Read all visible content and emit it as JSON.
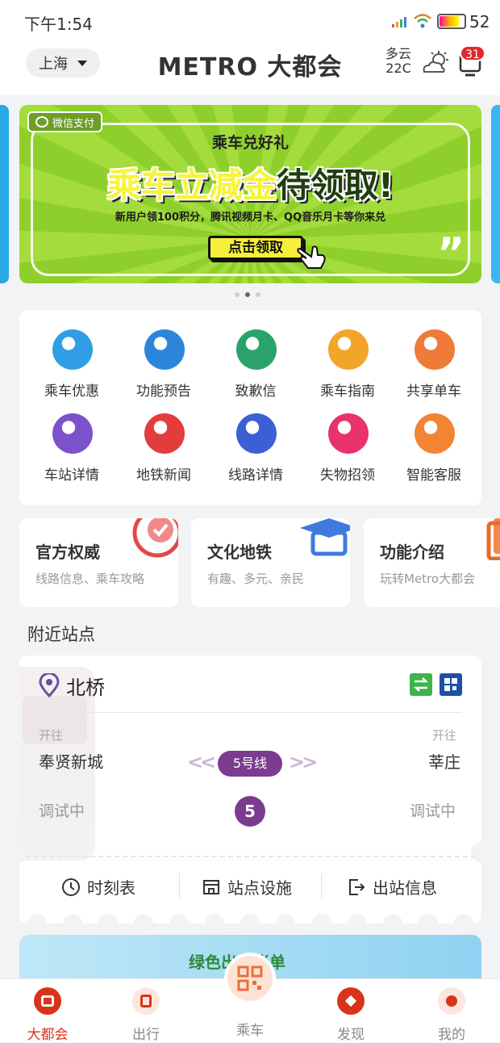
{
  "status_bar": {
    "time": "下午1:54",
    "battery": "52"
  },
  "header": {
    "city": "上海",
    "title": "METRO 大都会",
    "weather_desc": "多云",
    "weather_temp": "22C",
    "message_badge": "31"
  },
  "banner": {
    "tag": "微信支付",
    "subtitle": "乘车兑好礼",
    "headline_part1": "乘车立减金",
    "headline_part2": "待领取!",
    "description": "新用户领100积分，腾讯视频月卡、QQ音乐月卡等你来兑",
    "button": "点击领取",
    "page_count": 3,
    "active_page": 2
  },
  "quick_services": [
    {
      "label": "乘车优惠",
      "icon": "ticket-icon",
      "color": "#2f9ee6"
    },
    {
      "label": "功能预告",
      "icon": "pie-chart-icon",
      "color": "#2b86d9"
    },
    {
      "label": "致歉信",
      "icon": "letter-icon",
      "color": "#2aa36b"
    },
    {
      "label": "乘车指南",
      "icon": "guide-icon",
      "color": "#f3a52a"
    },
    {
      "label": "共享单车",
      "icon": "bicycle-icon",
      "color": "#f07a38"
    },
    {
      "label": "车站详情",
      "icon": "train-icon",
      "color": "#7b52c9"
    },
    {
      "label": "地铁新闻",
      "icon": "news-icon",
      "color": "#e33c3c"
    },
    {
      "label": "线路详情",
      "icon": "map-route-icon",
      "color": "#3d5fd6"
    },
    {
      "label": "失物招领",
      "icon": "lost-found-icon",
      "color": "#e8336a"
    },
    {
      "label": "智能客服",
      "icon": "customer-service-icon",
      "color": "#f28434"
    }
  ],
  "feature_cards": [
    {
      "title": "官方权威",
      "desc": "线路信息、乘车攻略",
      "icon": "badge-icon"
    },
    {
      "title": "文化地铁",
      "desc": "有趣、多元、亲民",
      "icon": "graduation-cap-icon"
    },
    {
      "title": "功能介绍",
      "desc": "玩转Metro大都会",
      "icon": "book-icon"
    }
  ],
  "nearby": {
    "section_title": "附近站点",
    "station_name": "北桥",
    "left_dir_label": "开往",
    "left_destination": "奉贤新城",
    "right_dir_label": "开往",
    "right_destination": "莘庄",
    "line_badge": "5号线",
    "line_number": "5",
    "left_status": "调试中",
    "right_status": "调试中",
    "actions": {
      "timetable": "时刻表",
      "facilities": "站点设施",
      "exits": "出站信息"
    }
  },
  "promo": {
    "text": "绿色出行账单"
  },
  "tabbar": {
    "home": "大都会",
    "travel": "出行",
    "ride": "乘车",
    "discover": "发现",
    "mine": "我的"
  },
  "colors": {
    "accent": "#d9331a",
    "line5": "#7b3c8f",
    "banner_green": "#9bd634"
  }
}
